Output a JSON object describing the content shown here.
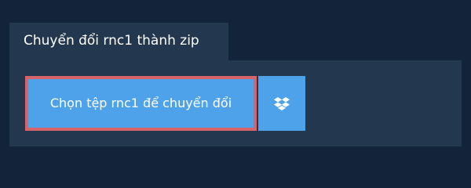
{
  "tab": {
    "label": "Chuyển đổi rnc1 thành zip"
  },
  "main": {
    "choose_file_label": "Chọn tệp rnc1 để chuyển đổi",
    "cloud_icon": "dropbox-icon"
  },
  "colors": {
    "background": "#13233a",
    "panel": "#23384f",
    "button": "#4da2e9",
    "button_border": "#d8646a",
    "text": "#ffffff"
  }
}
